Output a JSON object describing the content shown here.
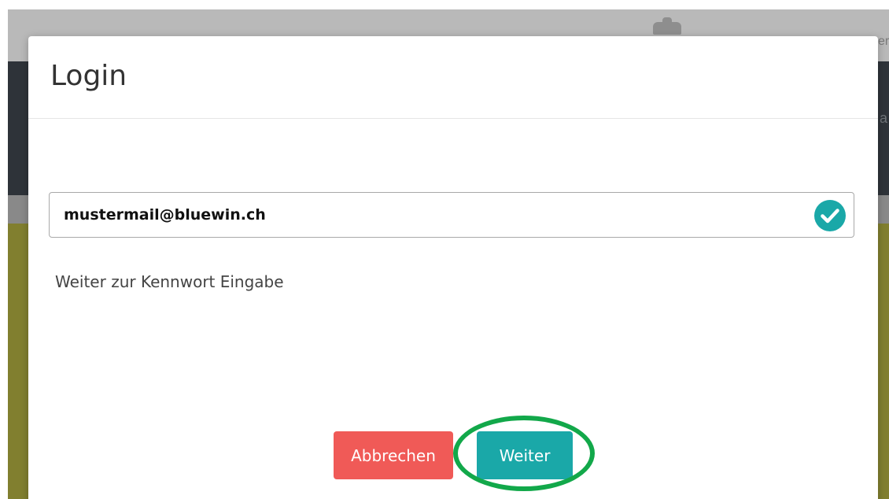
{
  "background": {
    "edge_text": "er",
    "edge_mark": "a"
  },
  "modal": {
    "title": "Login",
    "email": {
      "value": "mustermail@bluewin.ch",
      "valid_icon": "check-circle-icon",
      "valid_color": "#1aa8a8"
    },
    "hint": "Weiter zur Kennwort Eingabe",
    "buttons": {
      "cancel_label": "Abbrechen",
      "next_label": "Weiter"
    }
  },
  "colors": {
    "cancel_button": "#f05a57",
    "next_button": "#1aa8a8",
    "highlight_ring": "#12a84a",
    "navbar": "#2e3339",
    "olive": "#817f2f"
  }
}
